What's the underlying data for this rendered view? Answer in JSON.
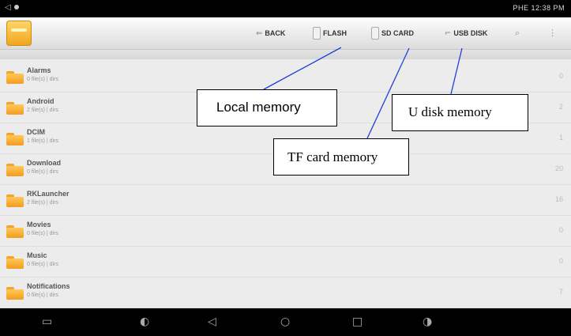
{
  "status_bar": {
    "left_text": "",
    "right_text": "PHE 12:38 PM"
  },
  "toolbar": {
    "buttons": [
      {
        "label": "BACK",
        "icon": "back-arrow-icon"
      },
      {
        "label": "FLASH",
        "icon": "flash-storage-icon"
      },
      {
        "label": "SD CARD",
        "icon": "sd-card-icon"
      },
      {
        "label": "USB DISK",
        "icon": "usb-disk-icon"
      }
    ]
  },
  "list": {
    "items": [
      {
        "name": "Alarms",
        "meta": "0 file(s) | dirs",
        "mark": "0"
      },
      {
        "name": "Android",
        "meta": "2 file(s) | dirs",
        "mark": "2"
      },
      {
        "name": "DCIM",
        "meta": "1 file(s) | dirs",
        "mark": "1"
      },
      {
        "name": "Download",
        "meta": "0 file(s) | dirs",
        "mark": "20"
      },
      {
        "name": "RKLauncher",
        "meta": "2 file(s) | dirs",
        "mark": "16"
      },
      {
        "name": "Movies",
        "meta": "0 file(s) | dirs",
        "mark": "0"
      },
      {
        "name": "Music",
        "meta": "0 file(s) | dirs",
        "mark": "0"
      },
      {
        "name": "Notifications",
        "meta": "0 file(s) | dirs",
        "mark": "7"
      }
    ]
  },
  "annotations": {
    "local": "Local memory",
    "tf": "TF card memory",
    "udisk": "U disk memory"
  },
  "colors": {
    "folder": "#f39c1e",
    "annotation_line": "#1f3fd8",
    "bars": "#000000"
  }
}
